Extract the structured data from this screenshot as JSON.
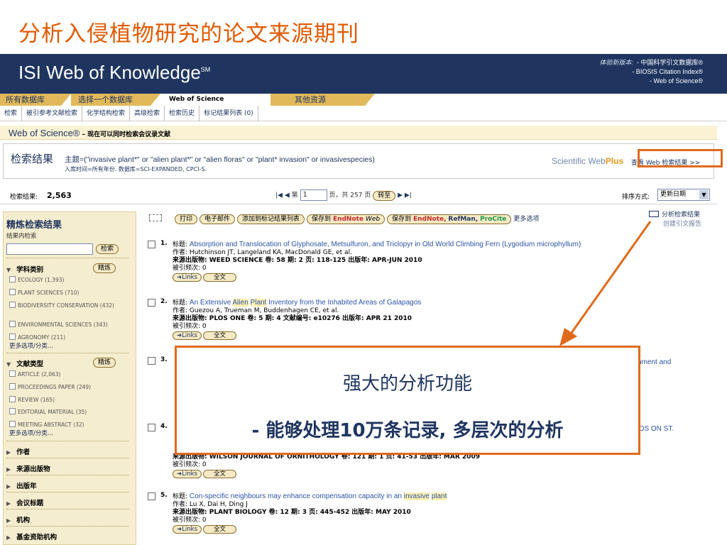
{
  "slide_title": "分析入侵植物研究的论文来源期刊",
  "header": {
    "logo": "ISI Web of Knowledge",
    "logo_sup": "SM",
    "links_label": "体验新版本:",
    "links": [
      "- 中国科学引文数据库®",
      "- BIOSIS Citation Index®",
      "- Web of Science®"
    ]
  },
  "tabs": [
    "所有数据库",
    "选择一个数据库",
    "Web of Science",
    "其他资源"
  ],
  "subnav": [
    "检索",
    "被引参考文献检索",
    "化学结构检索",
    "高级检索",
    "检索历史",
    "标记结果列表 (0)"
  ],
  "wos_bar": {
    "brand": "Web of Science®",
    "sub": " – 现在可以同时检索会议录文献"
  },
  "search": {
    "title": "检索结果",
    "query": "主题=(\"invasive plant*\" or \"alien plant*\" or \"alien floras\" or \"plant* invasion\" or invasivespecies)",
    "meta": "入库时间=所有年份. 数据库=SCI-EXPANDED, CPCI-S.",
    "webplus_prefix": "Scientific Web",
    "webplus_brand": "Plus",
    "webplus_link": "查看 Web 检索结果 >>"
  },
  "results_bar": {
    "label": "检索结果:",
    "count": "2,563",
    "page_prefix": "第",
    "page": "1",
    "page_suffix": "页，共 257 页",
    "go": "转至",
    "sort_label": "排序方式:",
    "sort_value": "更新日期"
  },
  "sidebar": {
    "title": "精炼检索结果",
    "within": "结果内检索",
    "search_btn": "检索",
    "refine_btn": "精炼",
    "sections": {
      "subject": "学科类别",
      "doctype": "文献类型",
      "author": "作者",
      "source": "来源出版物",
      "year": "出版年",
      "conference": "会议标题",
      "org": "机构",
      "funding": "基金资助机构"
    },
    "subject_items": [
      "ECOLOGY (1,393)",
      "PLANT SCIENCES (710)",
      "BIODIVERSITY CONSERVATION (432)",
      "ENVIRONMENTAL SCIENCES (343)",
      "AGRONOMY (211)"
    ],
    "doctype_items": [
      "ARTICLE (2,063)",
      "PROCEEDINGS PAPER (249)",
      "REVIEW (165)",
      "EDITORIAL MATERIAL (35)",
      "MEETING ABSTRACT (32)"
    ],
    "more": "更多选项/分类..."
  },
  "toolbar": {
    "print": "打印",
    "email": "电子邮件",
    "add_marked": "添加到标记结果列表",
    "save_to": "保存到",
    "endnote": "EndNote",
    "endnote_web": "Web",
    "save_to2": "保存到",
    "endnote2": "EndNote,",
    "refman": "RefMan,",
    "procite": "ProCite",
    "more": "更多选项"
  },
  "analyze": {
    "label": "分析检索结果",
    "sub": "创建引文报告"
  },
  "results": [
    {
      "num": "1.",
      "title": "Absorption and Translocation of Glyphosate, Metsulfuron, and Triclopyr in Old World Climbing Fern (Lygodium microphyllum)",
      "authors": "作者: Hutchinson JT, Langeland KA, MacDonald GE, et al.",
      "source": "来源出版物: WEED SCIENCE  卷: 58  期: 2  页: 118-125  出版年: APR-JUN 2010",
      "cited": "被引频次: 0"
    },
    {
      "num": "2.",
      "title_pre": "An Extensive ",
      "title_hl1": "Alien",
      "title_mid": " ",
      "title_hl2": "Plant",
      "title_post": " Inventory from the Inhabited Areas of Galapagos",
      "authors": "作者: Guezou A, Trueman M, Buddenhagen CE, et al.",
      "source": "来源出版物: PLOS ONE  卷: 5  期: 4 文献编号: e10276  出版年: APR 21 2010",
      "cited": "被引频次: 0"
    },
    {
      "num": "3.",
      "title_tail": "shment and"
    },
    {
      "num": "4.",
      "title_tail": "RDS ON ST.",
      "source": "来源出版物: WILSON JOURNAL OF ORNITHOLOGY  卷: 121  期: 1  页: 41-53  出版年: MAR 2009",
      "cited": "被引频次: 0"
    },
    {
      "num": "5.",
      "title_pre": "Con-specific neighbours may enhance compensation capacity in an ",
      "title_hl1": "invasive",
      "title_mid": " ",
      "title_hl2": "plant",
      "authors": "作者: Lu X, Dai H, Ding J",
      "source": "来源出版物: PLANT BIOLOGY  卷: 12  期: 3  页: 445-452  出版年: MAY 2010",
      "cited": "被引频次: 0"
    }
  ],
  "title_label": "标题:",
  "links_btn": "Links",
  "fulltext_btn": "全文",
  "callout": {
    "line1": "强大的分析功能",
    "line2": "- 能够处理10万条记录, 多层次的分析"
  },
  "colors": {
    "accent": "#e06a1b",
    "header_bg": "#1f3560",
    "link": "#2b54a8",
    "sidebar_bg": "#f5edcf"
  }
}
